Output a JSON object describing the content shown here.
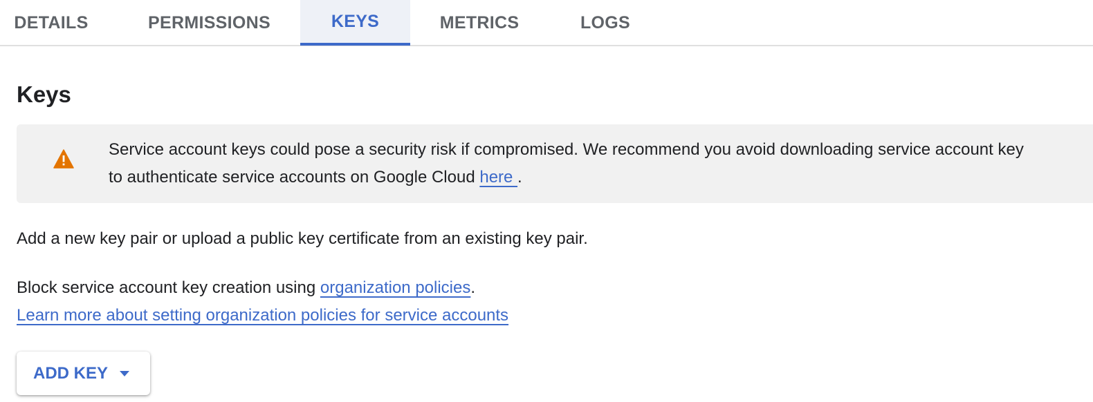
{
  "tabs": [
    {
      "label": "DETAILS",
      "active": false
    },
    {
      "label": "PERMISSIONS",
      "active": false
    },
    {
      "label": "KEYS",
      "active": true
    },
    {
      "label": "METRICS",
      "active": false
    },
    {
      "label": "LOGS",
      "active": false
    }
  ],
  "page_title": "Keys",
  "banner": {
    "icon": "warning-icon",
    "line1": "Service account keys could pose a security risk if compromised. We recommend you avoid downloading service account key",
    "line2_prefix": "to authenticate service accounts on Google Cloud ",
    "link_label": "here ",
    "line2_suffix": "."
  },
  "intro_text": "Add a new key pair or upload a public key certificate from an existing key pair.",
  "policy": {
    "prefix": "Block service account key creation using ",
    "link_label": "organization policies",
    "suffix": ".",
    "learn_more_label": "Learn more about setting organization policies for service accounts"
  },
  "add_key_button": {
    "label": "ADD KEY",
    "icon": "caret-down-icon"
  },
  "colors": {
    "accent": "#3d6ac9",
    "warning": "#e37400",
    "active_tab_bg": "#eef1f7",
    "banner_bg": "#f1f1f1"
  }
}
